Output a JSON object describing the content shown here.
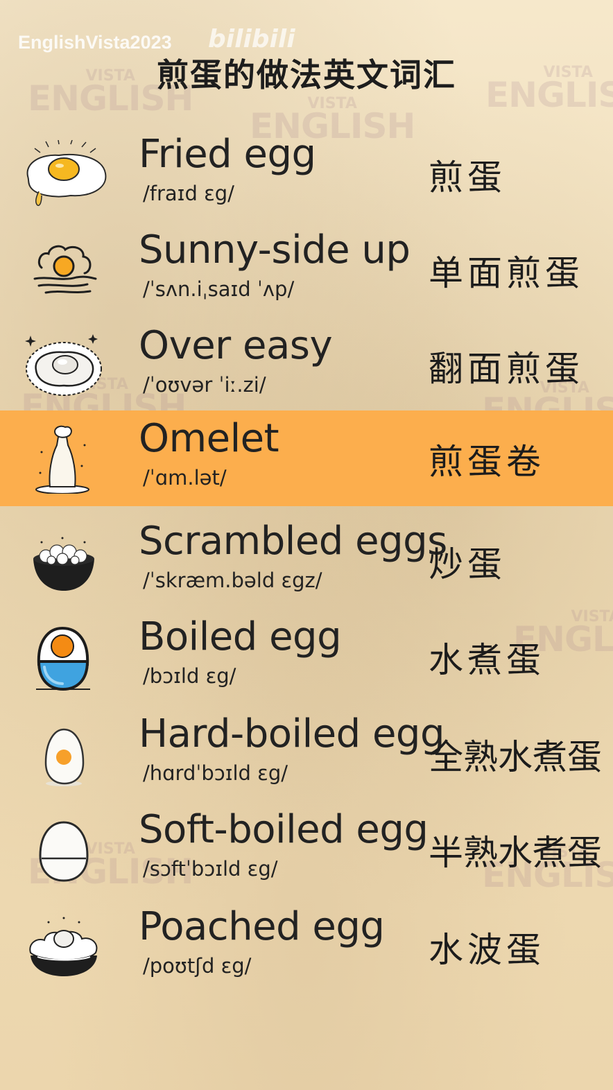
{
  "watermark": {
    "brand": "EnglishVista2023",
    "platform": "bilibili",
    "logo_small": "VISTA",
    "logo_big": "ENGLISH"
  },
  "title": "煎蛋的做法英文词汇",
  "highlight_color": "#fcae4d",
  "items": [
    {
      "icon": "fried-egg-icon",
      "en": "Fried egg",
      "ipa": "/fraɪd ɛg/",
      "zh": "煎蛋"
    },
    {
      "icon": "sunny-side-up-icon",
      "en": "Sunny-side up",
      "ipa": "/ˈsʌn.iˌsaɪd ˈʌp/",
      "zh": "单面煎蛋"
    },
    {
      "icon": "over-easy-icon",
      "en": "Over easy",
      "ipa": "/ˈoʊvər ˈiː.zi/",
      "zh": "翻面煎蛋"
    },
    {
      "icon": "omelet-icon",
      "en": "Omelet",
      "ipa": "/ˈɑm.lət/",
      "zh": "煎蛋卷",
      "highlighted": true
    },
    {
      "icon": "scrambled-eggs-icon",
      "en": "Scrambled eggs",
      "ipa": "/ˈskræm.bəld ɛgz/",
      "zh": "炒蛋"
    },
    {
      "icon": "boiled-egg-icon",
      "en": "Boiled egg",
      "ipa": "/bɔɪld ɛg/",
      "zh": "水煮蛋"
    },
    {
      "icon": "hard-boiled-egg-icon",
      "en": "Hard-boiled egg",
      "ipa": "/hɑrdˈbɔɪld ɛg/",
      "zh": "全熟水煮蛋"
    },
    {
      "icon": "soft-boiled-egg-icon",
      "en": "Soft-boiled egg",
      "ipa": "/sɔftˈbɔɪld ɛg/",
      "zh": "半熟水煮蛋"
    },
    {
      "icon": "poached-egg-icon",
      "en": "Poached egg",
      "ipa": "/poʊtʃd ɛg/",
      "zh": "水波蛋"
    }
  ]
}
